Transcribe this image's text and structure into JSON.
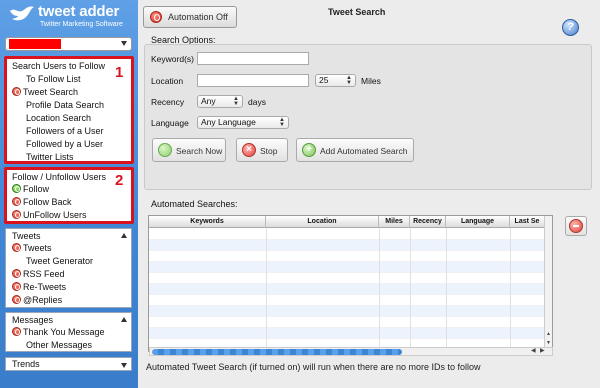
{
  "app": {
    "logo_name": "tweet adder",
    "logo_tagline": "Twitter Marketing Software"
  },
  "toolbar": {
    "automation_label": "Automation Off",
    "page_title": "Tweet Search",
    "help_glyph": "?"
  },
  "sidebar": {
    "follow_section": {
      "header": "Search Users to Follow",
      "items": [
        "To Follow List",
        "Tweet Search",
        "Profile Data Search",
        "Location Search",
        "Followers of a User",
        "Followed by a User",
        "Twitter Lists"
      ],
      "marker": "1"
    },
    "unfollow_section": {
      "header": "Follow / Unfollow Users",
      "items": [
        "Follow",
        "Follow Back",
        "UnFollow Users"
      ],
      "marker": "2"
    },
    "tweets_section": {
      "header": "Tweets",
      "items": [
        "Tweets",
        "Tweet Generator",
        "RSS Feed",
        "Re-Tweets",
        "@Replies"
      ]
    },
    "messages_section": {
      "header": "Messages",
      "items": [
        "Thank You Message",
        "Other Messages"
      ]
    },
    "trends_section": {
      "header": "Trends"
    }
  },
  "search_options": {
    "section_label": "Search Options:",
    "keywords_label": "Keyword(s)",
    "keywords_value": "",
    "location_label": "Location",
    "location_value": "",
    "miles_value": "25",
    "miles_label": "Miles",
    "recency_label": "Recency",
    "recency_value": "Any",
    "recency_unit": "days",
    "language_label": "Language",
    "language_value": "Any Language",
    "search_now_label": "Search Now",
    "stop_label": "Stop",
    "add_automated_label": "Add Automated Search"
  },
  "automated": {
    "section_label": "Automated Searches:",
    "columns": [
      "Keywords",
      "Location",
      "Miles",
      "Recency",
      "Language",
      "Last Se"
    ]
  },
  "status_text": "Automated Tweet Search (if turned on) will run when there are no more IDs to follow",
  "colors": {
    "sidebar_blue": "#4a8ee0",
    "highlight_red": "#d9131e"
  }
}
